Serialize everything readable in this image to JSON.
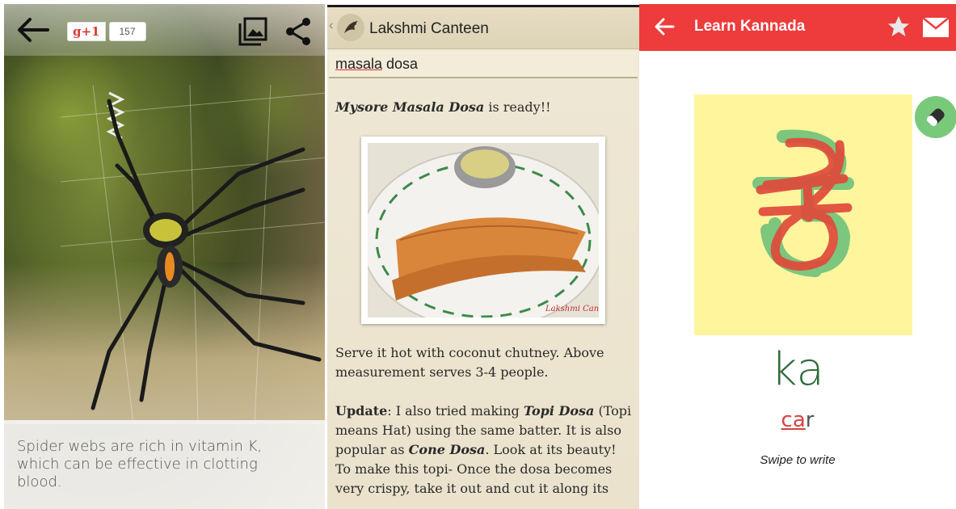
{
  "spider_panel": {
    "gplus_label": "g+1",
    "gplus_count": "157",
    "fact_text": "Spider webs are rich in vitamin K, which can be effective in clotting blood."
  },
  "recipe_panel": {
    "app_title": "Lakshmi Canteen",
    "search_text_underlined": "masala",
    "search_text_rest": " dosa",
    "ready_bold": "Mysore Masala Dosa",
    "ready_rest": " is ready!!",
    "serve_text": "Serve it hot with coconut chutney. Above measurement serves 3-4 people.",
    "update_label": "Update",
    "update_text_1": ": I also tried making ",
    "update_bold_1": "Topi Dosa",
    "update_text_2": " (Topi means Hat) using the same batter. It is also popular as ",
    "update_bold_2": "Cone Dosa",
    "update_text_3": ". Look at its beauty!",
    "topi_text": "To make this topi- Once the dosa becomes very crispy, take it out and cut it along its",
    "photo_watermark": "Lakshmi Canteen"
  },
  "kannada_panel": {
    "title": "Learn Kannada",
    "letter": "ಕ",
    "transliteration": "ka",
    "word_highlight": "ca",
    "word_rest": "r",
    "hint": "Swipe to write"
  },
  "colors": {
    "kannada_appbar": "#ee3b3b",
    "canvas_bg": "#fff59d",
    "letter_guide": "#7cc67e",
    "stroke": "#e04a3a",
    "gplus_red": "#d73d32"
  }
}
